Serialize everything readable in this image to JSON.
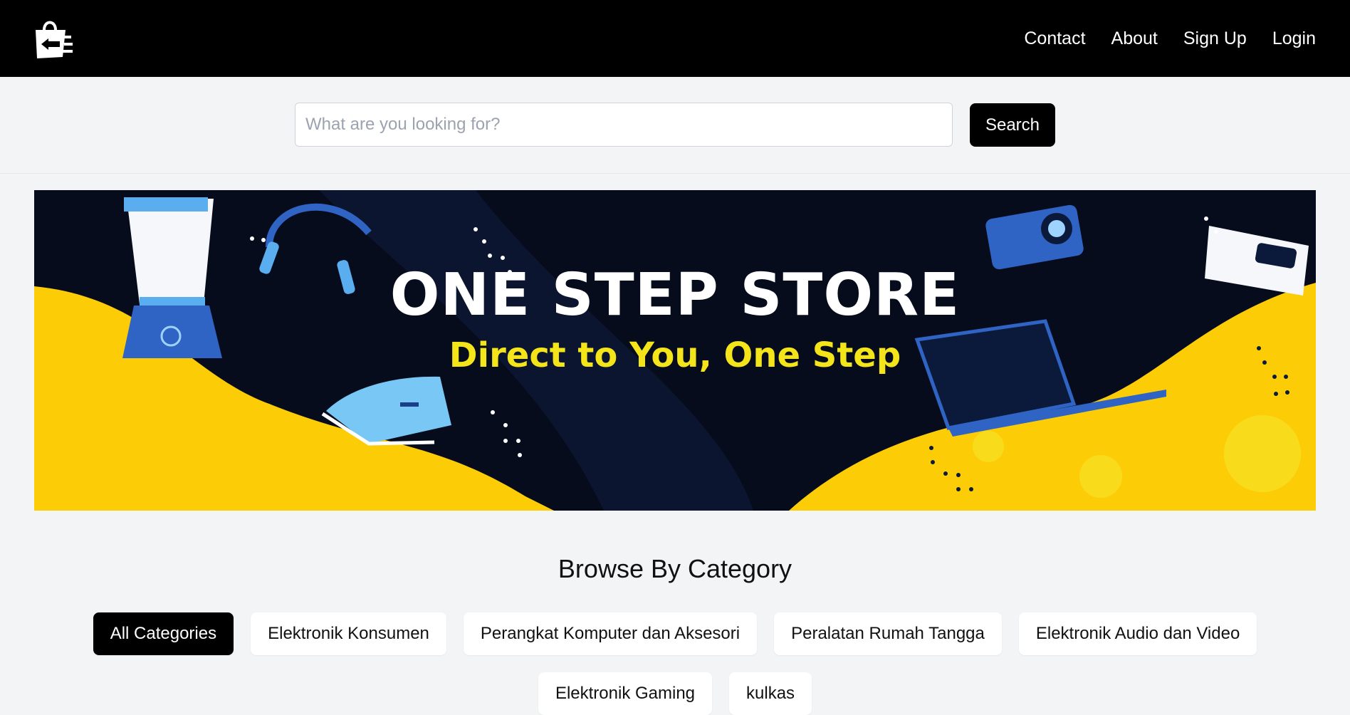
{
  "nav": {
    "logo_icon": "shopping-bag-logo-icon",
    "links": [
      "Contact",
      "About",
      "Sign Up",
      "Login"
    ]
  },
  "search": {
    "placeholder": "What are you looking for?",
    "value": "",
    "button_label": "Search"
  },
  "banner": {
    "title": "ONE STEP STORE",
    "subtitle": "Direct to You, One Step",
    "colors": {
      "background": "#060c1c",
      "accent_yellow": "#fccd07",
      "subtitle": "#f4e51a"
    }
  },
  "categories": {
    "title": "Browse By Category",
    "items": [
      "All Categories",
      "Elektronik Konsumen",
      "Perangkat Komputer dan Aksesori",
      "Peralatan Rumah Tangga",
      "Elektronik Audio dan Video",
      "Elektronik Gaming",
      "kulkas"
    ],
    "active": "All Categories"
  }
}
